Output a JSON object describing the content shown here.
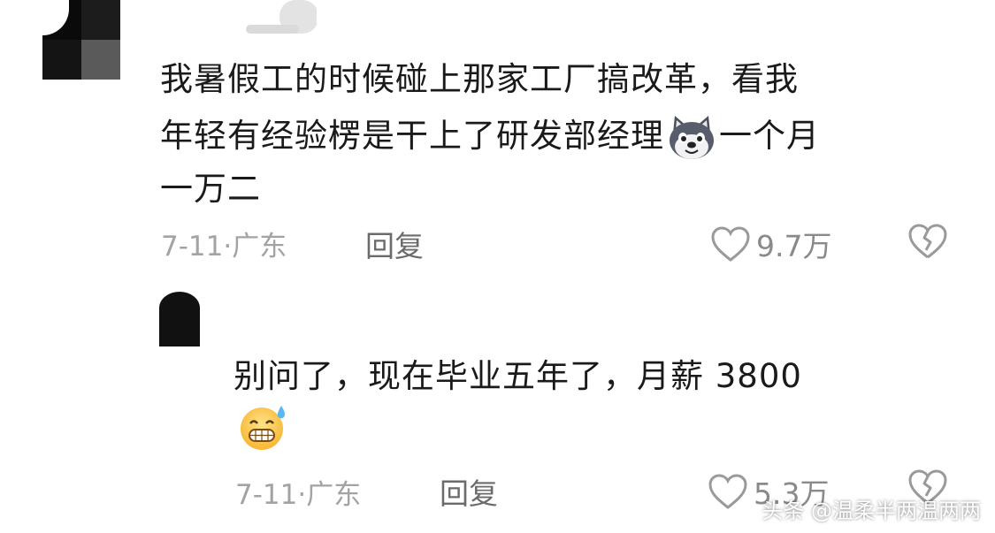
{
  "comment1": {
    "lines": [
      "我暑假工的时候碰上那家工厂搞改革，看我",
      "年轻有经验楞是干上了研发部经理",
      "一个月",
      "一万二"
    ],
    "emoji": "dog-face-emoji",
    "date": "7-11·",
    "location": "广东",
    "reply_label": "回复",
    "likes": "9.7万"
  },
  "comment2": {
    "text": "别问了，现在毕业五年了，月薪 3800",
    "emoji": "grinning-sweat-emoji",
    "date": "7-11·",
    "location": "广东",
    "reply_label": "回复",
    "likes": "5.3万"
  },
  "watermark": "头条 @温柔半两温两两",
  "colors": {
    "text": "#1a1a1a",
    "meta": "#a3a3a3",
    "reply": "#6b6b6b"
  }
}
